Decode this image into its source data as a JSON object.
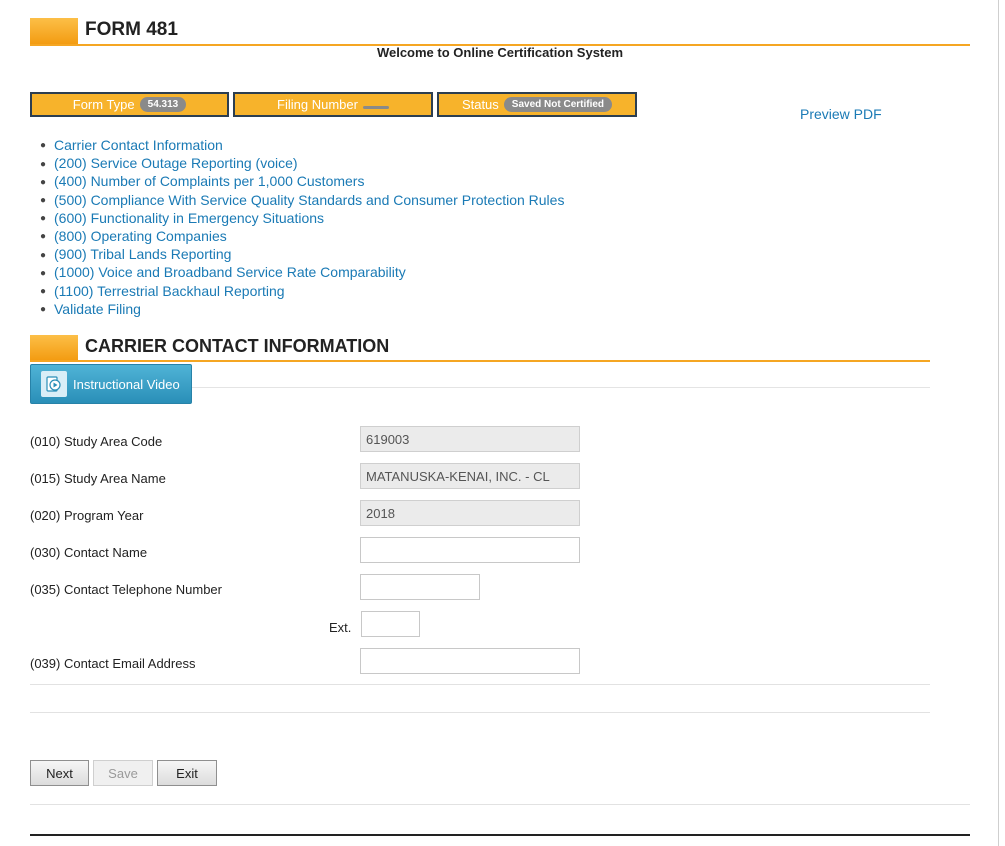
{
  "header": {
    "title": "FORM 481",
    "welcome": "Welcome to Online Certification System"
  },
  "status_bar": {
    "form_type_label": "Form Type",
    "form_type_value": "54.313",
    "filing_number_label": "Filing Number",
    "filing_number_value": "",
    "status_label": "Status",
    "status_value": "Saved Not Certified",
    "preview_pdf": "Preview PDF"
  },
  "nav": {
    "items": [
      {
        "label": "Carrier Contact Information"
      },
      {
        "label": "(200) Service Outage Reporting (voice)"
      },
      {
        "label": "(400) Number of Complaints per 1,000 Customers"
      },
      {
        "label": "(500) Compliance With Service Quality Standards and Consumer Protection Rules"
      },
      {
        "label": "(600) Functionality in Emergency Situations"
      },
      {
        "label": "(800) Operating Companies"
      },
      {
        "label": "(900) Tribal Lands Reporting"
      },
      {
        "label": "(1000) Voice and Broadband Service Rate Comparability"
      },
      {
        "label": "(1100) Terrestrial Backhaul Reporting"
      },
      {
        "label": "Validate Filing"
      }
    ]
  },
  "section": {
    "title": "CARRIER CONTACT INFORMATION",
    "video_button": "Instructional Video"
  },
  "fields": {
    "study_area_code": {
      "label": "(010) Study Area Code",
      "value": "619003"
    },
    "study_area_name": {
      "label": "(015) Study Area Name",
      "value": "MATANUSKA-KENAI, INC. - CL"
    },
    "program_year": {
      "label": "(020) Program Year",
      "value": "2018"
    },
    "contact_name": {
      "label": "(030) Contact Name",
      "value": ""
    },
    "contact_phone": {
      "label": "(035) Contact Telephone Number",
      "value": ""
    },
    "ext": {
      "label": "Ext.",
      "value": ""
    },
    "contact_email": {
      "label": "(039) Contact Email Address",
      "value": ""
    }
  },
  "buttons": {
    "next": "Next",
    "save": "Save",
    "exit": "Exit"
  },
  "colors": {
    "accent_orange": "#f5a623",
    "link_blue": "#1a7ab5",
    "video_blue": "#2a8fb8",
    "status_pill_gray": "#8a8a8a"
  },
  "icons": {
    "video": "video-play-icon"
  }
}
